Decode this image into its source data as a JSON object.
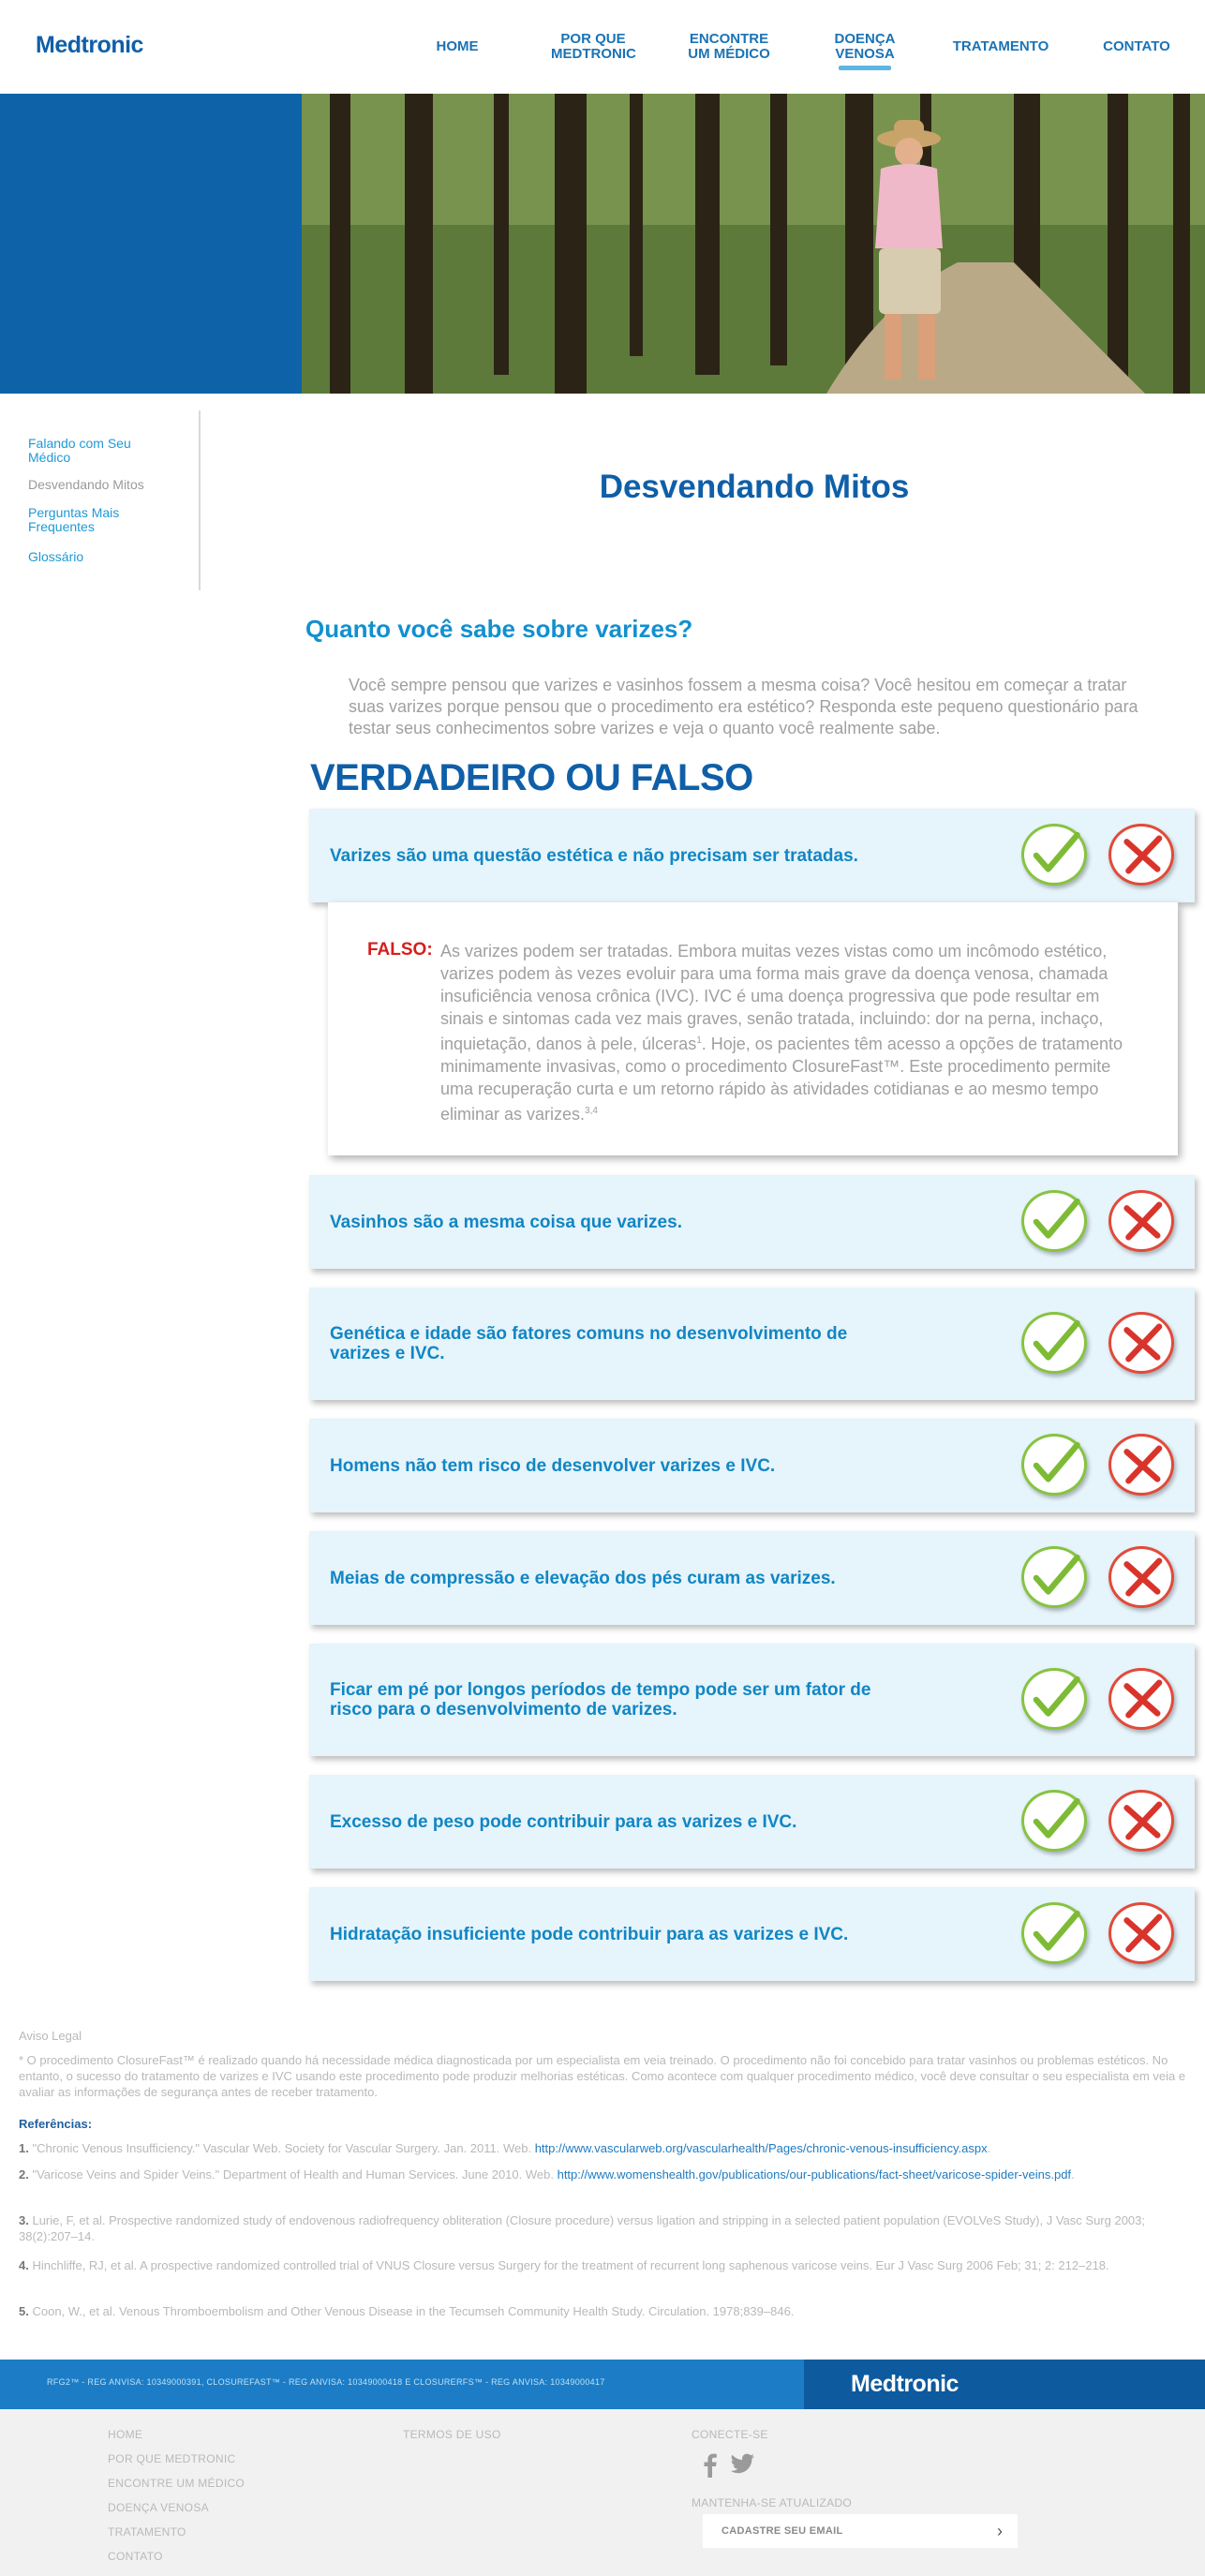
{
  "brand": {
    "logo": "Medtronic",
    "primary": "#0f5fa8",
    "accent": "#1d9ad6"
  },
  "nav": [
    {
      "label": "HOME"
    },
    {
      "label": "POR QUE MEDTRONIC"
    },
    {
      "label": "ENCONTRE UM MÉDICO"
    },
    {
      "label": "DOENÇA VENOSA",
      "active": true
    },
    {
      "label": "TRATAMENTO"
    },
    {
      "label": "CONTATO"
    }
  ],
  "sidebar": {
    "items": [
      {
        "label": "Falando com Seu Médico"
      },
      {
        "label": "Desvendando Mitos",
        "active": true
      },
      {
        "label": "Perguntas Mais Frequentes"
      },
      {
        "label": "Glossário"
      }
    ]
  },
  "main": {
    "title": "Desvendando Mitos",
    "subtitle": "Quanto você sabe sobre varizes?",
    "intro": "Você sempre pensou que varizes e vasinhos fossem a mesma coisa? Você hesitou em começar a tratar suas varizes porque pensou que o procedimento era estético? Responda este pequeno questionário para testar seus conhecimentos sobre varizes e veja o quanto você realmente sabe.",
    "quiz_heading": "VERDADEIRO OU FALSO",
    "questions": [
      {
        "text": "Varizes são uma questão estética e não precisam ser tratadas."
      },
      {
        "text": "Vasinhos são a mesma coisa que varizes."
      },
      {
        "text": "Genética e idade são fatores comuns no desenvolvimento de varizes e IVC."
      },
      {
        "text": "Homens não tem risco de desenvolver varizes e IVC."
      },
      {
        "text": "Meias de compressão e elevação dos pés curam as varizes."
      },
      {
        "text": "Ficar em pé por longos períodos de tempo pode ser um fator de risco para o desenvolvimento de varizes."
      },
      {
        "text": "Excesso de peso pode contribuir para as varizes e IVC."
      },
      {
        "text": "Hidratação insuficiente pode contribuir para as varizes e IVC."
      }
    ],
    "answer": {
      "label": "FALSO:",
      "text": "As varizes podem ser tratadas. Embora muitas vezes vistas como um incômodo estético, varizes podem às vezes evoluir para uma forma mais grave da doença venosa, chamada insuficiência venosa crônica (IVC). IVC é uma doença progressiva que pode resultar em sinais e sintomas cada vez mais graves, senão tratada, incluindo: dor na perna, inchaço, inquietação, danos à pele, úlceras",
      "sup1": "1",
      "text2": ". Hoje, os pacientes têm acesso a opções de tratamento minimamente invasivas, como o procedimento ClosureFast™. Este procedimento permite uma recuperação curta e um retorno rápido às atividades cotidianas e ao mesmo tempo eliminar as varizes.",
      "sup2": "3,4"
    }
  },
  "legal": {
    "title": "Aviso Legal",
    "disclaimer": "* O procedimento ClosureFast™ é realizado quando há necessidade médica diagnosticada por um especialista em veia treinado. O procedimento não foi concebido para tratar vasinhos ou problemas estéticos. No entanto, o sucesso do tratamento de varizes e IVC usando este procedimento pode produzir melhorias estéticas. Como acontece com qualquer procedimento médico, você deve consultar o seu especialista em veia e avaliar as informações de segurança antes de receber tratamento.",
    "refs_title": "Referências:",
    "refs": [
      {
        "num": "1.",
        "text": "\"Chronic Venous Insufficiency.\" Vascular Web. Society for Vascular Surgery. Jan. 2011. Web. ",
        "link": "http://www.vascularweb.org/vascularhealth/Pages/chronic-venous-insufficiency.aspx",
        "after": "."
      },
      {
        "num": "2.",
        "text": "\"Varicose Veins and Spider Veins.\" Department of Health and Human Services. June 2010. Web. ",
        "link": "http://www.womenshealth.gov/publications/our-publications/fact-sheet/varicose-spider-veins.pdf",
        "after": "."
      },
      {
        "num": "3.",
        "text": "Lurie, F, et al. Prospective randomized study of endovenous radiofrequency obliteration (Closure procedure) versus ligation and stripping in a selected patient population (EVOLVeS Study), J Vasc Surg 2003; 38(2):207–14.",
        "link": "",
        "after": ""
      },
      {
        "num": "4.",
        "text": "Hinchliffe, RJ, et al. A prospective randomized controlled trial of VNUS Closure versus Surgery for the treatment of recurrent long saphenous varicose veins. Eur J Vasc Surg 2006 Feb; 31; 2: 212–218.",
        "link": "",
        "after": ""
      },
      {
        "num": "5.",
        "text": "Coon, W., et al. Venous Thromboembolism and Other Venous Disease in the Tecumseh Community Health Study. Circulation. 1978;839–846.",
        "link": "",
        "after": ""
      }
    ]
  },
  "footer": {
    "reg": "RFG2™ - REG ANVISA: 10349000391, CLOSUREFAST™ - REG ANVISA: 10349000418 E CLOSURERFS™ - REG ANVISA: 10349000417",
    "logo": "Medtronic",
    "links": [
      "HOME",
      "POR QUE MEDTRONIC",
      "ENCONTRE UM MÉDICO",
      "DOENÇA VENOSA",
      "TRATAMENTO",
      "CONTATO"
    ],
    "terms": "TERMOS DE USO",
    "connect": "CONECTE-SE",
    "social_icons": [
      "facebook-icon",
      "twitter-icon"
    ],
    "newsletter": "MANTENHA-SE ATUALIZADO",
    "email_placeholder": "CADASTRE SEU EMAIL",
    "arrow": "›"
  }
}
